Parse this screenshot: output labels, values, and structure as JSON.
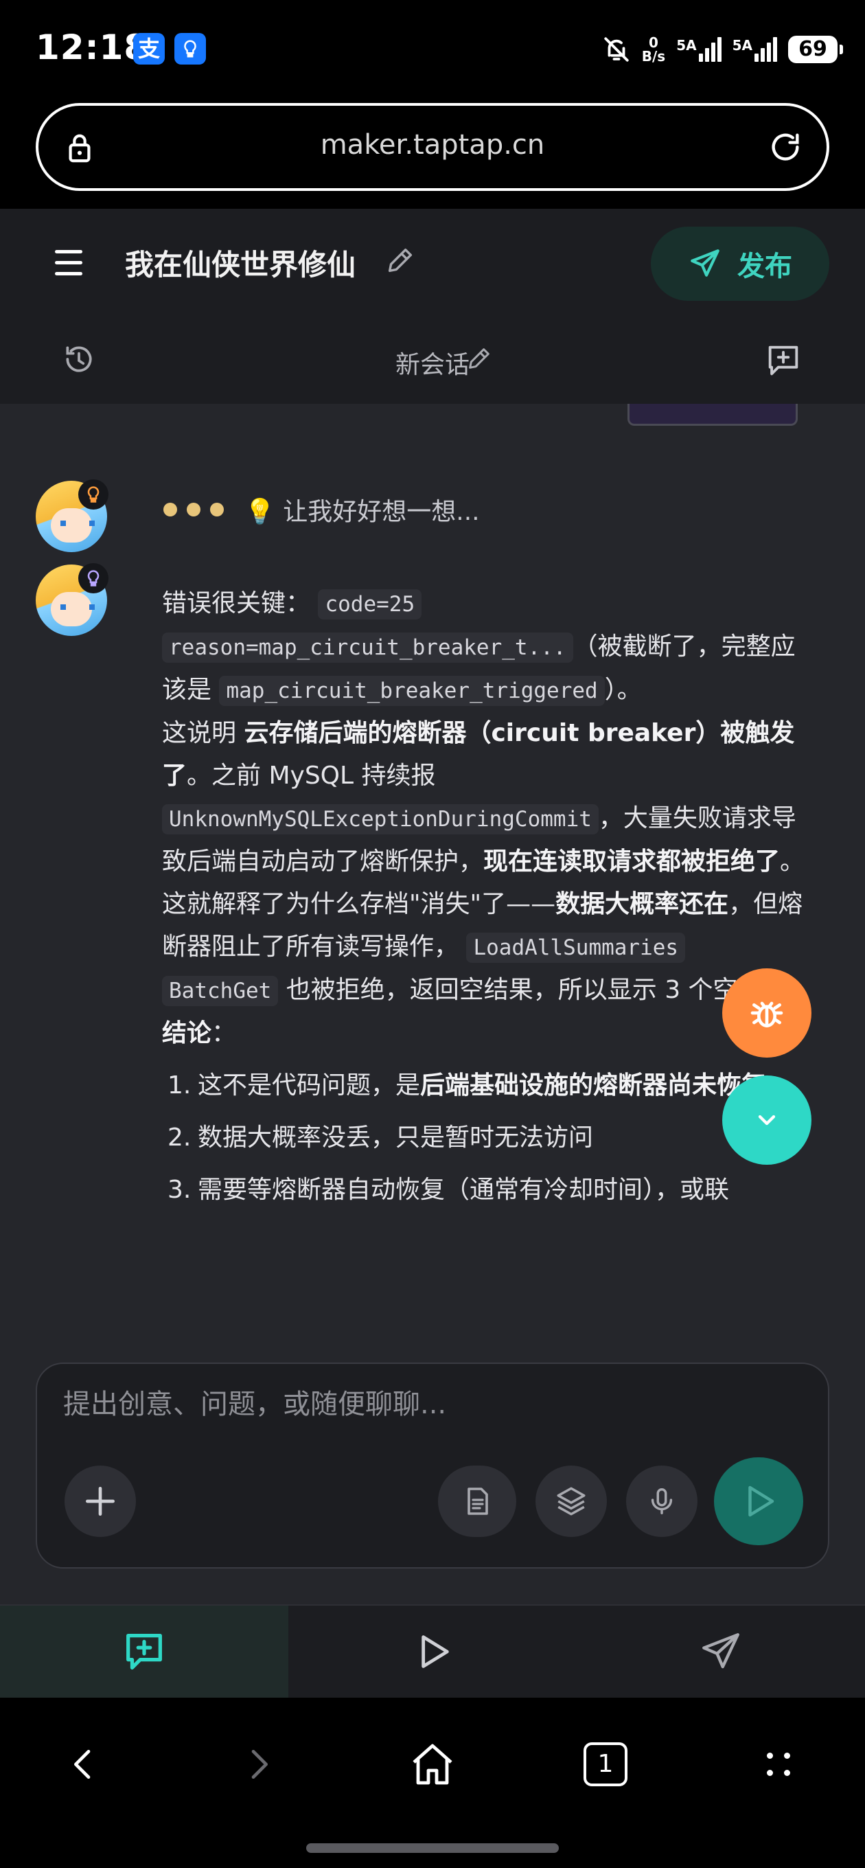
{
  "status_bar": {
    "time": "12:18",
    "app_badge_alipay": "支",
    "net_speed_value": "0",
    "net_speed_unit": "B/s",
    "signal1_label": "5A",
    "signal2_label": "5A",
    "battery": "69"
  },
  "browser": {
    "url": "maker.taptap.cn"
  },
  "header": {
    "project_title": "我在仙侠世界修仙",
    "publish_label": "发布",
    "session_title": "新会话"
  },
  "chat": {
    "thinking_text": "💡 让我好好想一想...",
    "message": {
      "p1_a": "错误很关键：",
      "p1_code1": "code=25",
      "p1_code2": "reason=map_circuit_breaker_t...",
      "p1_b": "（被截断了，完整应该是",
      "p1_code3": "map_circuit_breaker_triggered",
      "p1_c": "）。",
      "p2_a": "这说明",
      "p2_bold1": "云存储后端的熔断器（circuit breaker）被触发了",
      "p2_b": "。之前 MySQL 持续报",
      "p2_code": "UnknownMySQLExceptionDuringCommit",
      "p2_c": "，大量失败请求导致后端自动启动了熔断保护，",
      "p2_bold2": "现在连读取请求都被拒绝了",
      "p2_d": "。",
      "p3_a": "这就解释了为什么存档\"消失\"了——",
      "p3_bold": "数据大概率还在",
      "p3_b": "，但熔断器阻止了所有读写操作，",
      "p3_code1": "LoadAllSummaries",
      "p3_code2": "BatchGet",
      "p3_c": "也被拒绝，返回空结果，所以显示 3 个空位。",
      "conclusion_label": "结论",
      "conclusion_colon": "：",
      "list": [
        {
          "num": "1.",
          "text": "这不是代码问题，是",
          "bold": "后端基础设施的熔断器尚未恢复"
        },
        {
          "num": "2.",
          "text": "数据大概率没丢，只是暂时无法访问",
          "bold": ""
        },
        {
          "num": "3.",
          "text": "需要等熔断器自动恢复（通常有冷却时间），或联",
          "bold": ""
        }
      ]
    }
  },
  "composer": {
    "placeholder": "提出创意、问题，或随便聊聊..."
  },
  "colors": {
    "accent_teal": "#2ed8c6",
    "bug_orange": "#ff8a3d",
    "panel_bg": "#1c1d21",
    "chat_bg": "#25262b"
  },
  "icons": [
    "lock-icon",
    "reload-icon",
    "menu-icon",
    "pencil-icon",
    "send-plane-icon",
    "history-icon",
    "new-chat-icon",
    "bulb-icon",
    "bug-icon",
    "chevron-down-icon",
    "plus-icon",
    "document-icon",
    "layers-icon",
    "microphone-icon",
    "play-icon",
    "chat-add-icon",
    "back-icon",
    "forward-icon",
    "home-icon",
    "tabs-icon",
    "more-icon"
  ],
  "system_nav": {
    "tabs_count": "1"
  }
}
